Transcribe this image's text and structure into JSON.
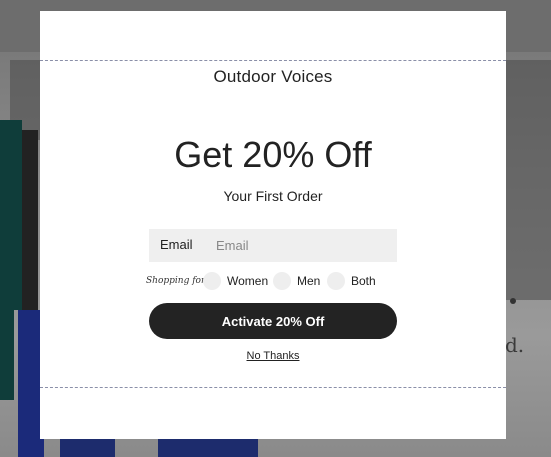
{
  "modal": {
    "brand": "Outdoor Voices",
    "headline": "Get 20% Off",
    "subheadline": "Your First Order",
    "email": {
      "label": "Email",
      "placeholder": "Email",
      "value": ""
    },
    "shopping_for": {
      "label": "Shopping for:",
      "options": [
        "Women",
        "Men",
        "Both"
      ],
      "selected": null
    },
    "cta_label": "Activate 20% Off",
    "dismiss_label": "No Thanks"
  },
  "background": {
    "visible_text": "d."
  },
  "colors": {
    "overlay": "#7f7f7f",
    "modal_bg": "#ffffff",
    "cta_bg": "#232323",
    "cta_text": "#ffffff",
    "input_bg": "#efefef",
    "dash": "#8a8fa8"
  }
}
